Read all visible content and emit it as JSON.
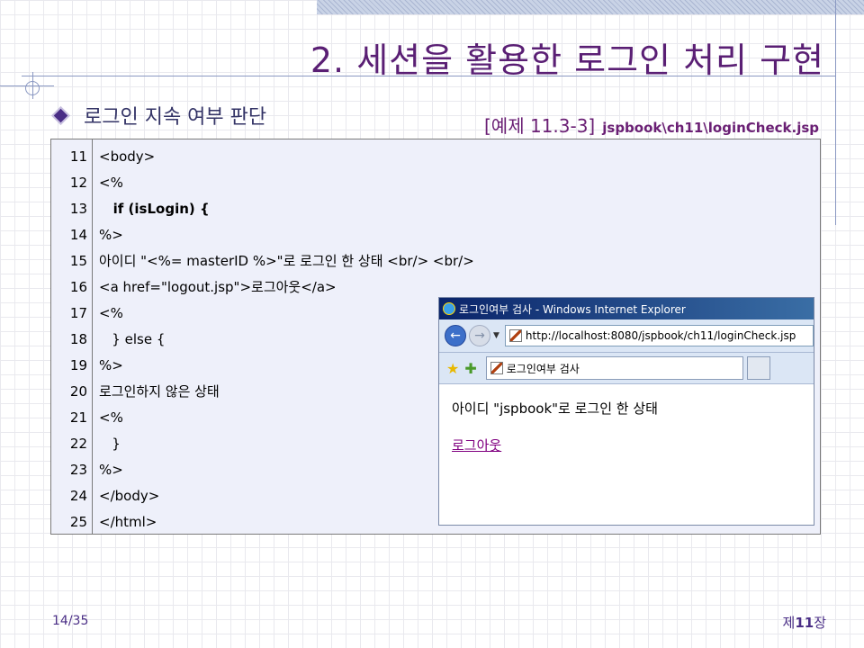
{
  "slide": {
    "title": "2. 세션을 활용한 로그인 처리 구현",
    "bullet": "로그인 지속 여부 판단",
    "example_label": "[예제 11.3-3]",
    "example_path": "jspbook\\ch11\\loginCheck.jsp"
  },
  "code": {
    "lines": [
      {
        "num": "11",
        "text": "<body>",
        "bold": false
      },
      {
        "num": "12",
        "text": "<%",
        "bold": false
      },
      {
        "num": "13",
        "text": "   if (isLogin) {",
        "bold": true
      },
      {
        "num": "14",
        "text": "%>",
        "bold": false
      },
      {
        "num": "15",
        "text": "아이디 \"<%= masterID %>\"로 로그인 한 상태 <br/> <br/>",
        "bold": false
      },
      {
        "num": "16",
        "text": "<a href=\"logout.jsp\">로그아웃</a>",
        "bold": false
      },
      {
        "num": "17",
        "text": "<%",
        "bold": false
      },
      {
        "num": "18",
        "text": "   } else {",
        "bold": false
      },
      {
        "num": "19",
        "text": "%>",
        "bold": false
      },
      {
        "num": "20",
        "text": "로그인하지 않은 상태",
        "bold": false
      },
      {
        "num": "21",
        "text": "<%",
        "bold": false
      },
      {
        "num": "22",
        "text": "   }",
        "bold": false
      },
      {
        "num": "23",
        "text": "%>",
        "bold": false
      },
      {
        "num": "24",
        "text": "</body>",
        "bold": false
      },
      {
        "num": "25",
        "text": "</html>",
        "bold": false
      }
    ]
  },
  "browser": {
    "window_title": "로그인여부 검사 - Windows Internet Explorer",
    "url": "http://localhost:8080/jspbook/ch11/loginCheck.jsp",
    "tab_title": "로그인여부 검사",
    "content_text": "아이디 \"jspbook\"로 로그인 한 상태",
    "link_text": "로그아웃"
  },
  "footer": {
    "page": "14/35",
    "chapter_prefix": "제",
    "chapter_number": "11",
    "chapter_suffix": "장"
  },
  "colors": {
    "title": "#5a1f74",
    "code_background": "#eef0fa",
    "link_visited": "#800080"
  }
}
